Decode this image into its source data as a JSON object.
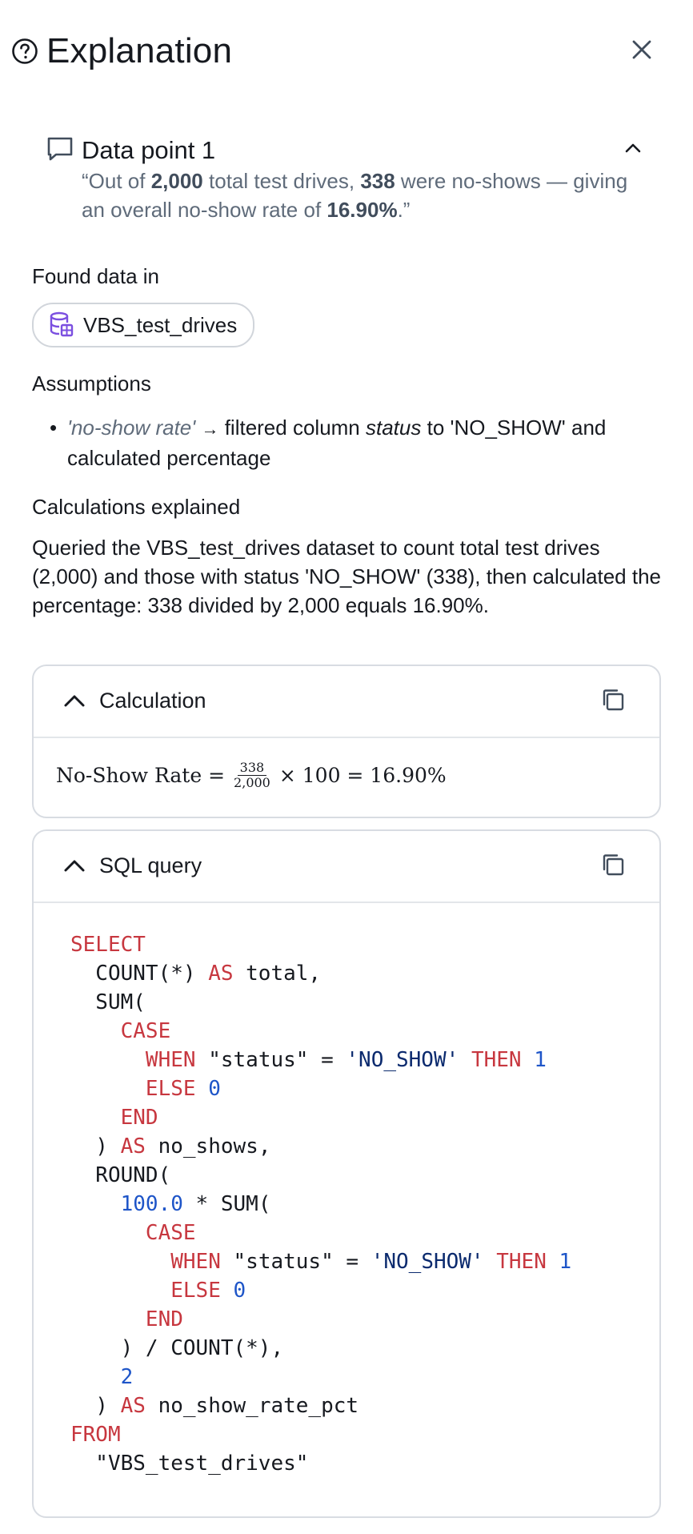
{
  "header": {
    "title": "Explanation",
    "help_icon": "question-circle-icon",
    "close_icon": "close-icon"
  },
  "datapoint": {
    "title": "Data point 1",
    "quote": {
      "open": "“Out of ",
      "total": "2,000",
      "mid1": " total test drives, ",
      "noshows": "338",
      "mid2": " were no-shows — giving an overall no-show rate of ",
      "rate": "16.90%",
      "close": ".”"
    }
  },
  "found": {
    "label": "Found data in",
    "dataset": "VBS_test_drives"
  },
  "assumptions": {
    "label": "Assumptions",
    "quoted": "'no-show rate'",
    "arrow": "→",
    "t1": " filtered column ",
    "col": "status",
    "t2": " to 'NO_SHOW' and calculated percentage"
  },
  "calc_explained": {
    "label": "Calculations explained",
    "text": "Queried the VBS_test_drives dataset to count total test drives (2,000) and those with status 'NO_SHOW' (338), then calculated the percentage: 338 divided by 2,000 equals 16.90%."
  },
  "calculation": {
    "title": "Calculation",
    "lhs": "No-Show Rate =",
    "num": "338",
    "den": "2,000",
    "rhs": "× 100 = 16.90%"
  },
  "sql": {
    "title": "SQL query"
  }
}
